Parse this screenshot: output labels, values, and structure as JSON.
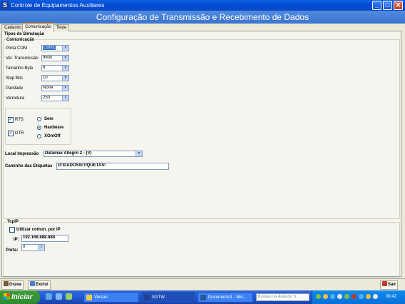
{
  "window": {
    "title": "Controle de Equipamentos Auxiliares",
    "app_icon_letter": "S",
    "controls": {
      "minimize": "_",
      "maximize": "□",
      "close": "✕"
    }
  },
  "banner": "Configuração de Transmissão e Recebimento de Dados",
  "tabs": [
    {
      "label": "Cadastro",
      "active": false
    },
    {
      "label": "Comunicação",
      "active": true
    },
    {
      "label": "Teste",
      "active": false
    }
  ],
  "form": {
    "simulation_label": "Tipos de Simulação",
    "comm_label": "Comunicação",
    "fields": [
      {
        "label": "Porta COM",
        "value": "Com1"
      },
      {
        "label": "Vel. Transmissão",
        "value": "9600"
      },
      {
        "label": "Tamanho Byte",
        "value": "8"
      },
      {
        "label": "Stop Bits",
        "value": "10"
      },
      {
        "label": "Paridade",
        "value": "None"
      },
      {
        "label": "Varredura",
        "value": "250"
      }
    ],
    "flow": {
      "rts_label": "RTS",
      "rts_checked": true,
      "dtr_label": "DTR",
      "dtr_checked": true,
      "options": [
        {
          "label": "Sem",
          "selected": false
        },
        {
          "label": "Hardware",
          "selected": true
        },
        {
          "label": "XOn/Off",
          "selected": false
        }
      ]
    },
    "print_label": "Local Impressão",
    "print_value": "Datamax Allegro 2 - (V)",
    "labels_path_label": "Caminho das Etiquetas",
    "labels_path_value": "D:\\DADOS\\ETIQUETAS\\"
  },
  "tcpip": {
    "group_label": "TcpIP",
    "use_ip_label": "Utilizar comun. por IP",
    "use_ip_checked": false,
    "ip_label": "IP:",
    "ip_value": "192.168.888.888",
    "port_label": "Porta:",
    "port_value": "0"
  },
  "toolbar": {
    "save_label": "Grava",
    "delete_label": "Exclui",
    "exit_label": "Sair"
  },
  "taskbar": {
    "start_label": "Iniciar",
    "tasks": [
      {
        "label": "Versao",
        "active": false
      },
      {
        "label": "SGTW",
        "active": true
      },
      {
        "label": "Documento1 - Mic...",
        "active": false
      }
    ],
    "search_placeholder": "Busque na Área de Tr",
    "clock": "09:42"
  },
  "colors": {
    "title_bar": "#0A5FE4",
    "banner": "#4F8BDE",
    "selection": "#316AC5",
    "taskbar": "#245EDC",
    "start": "#3C9B3C"
  }
}
